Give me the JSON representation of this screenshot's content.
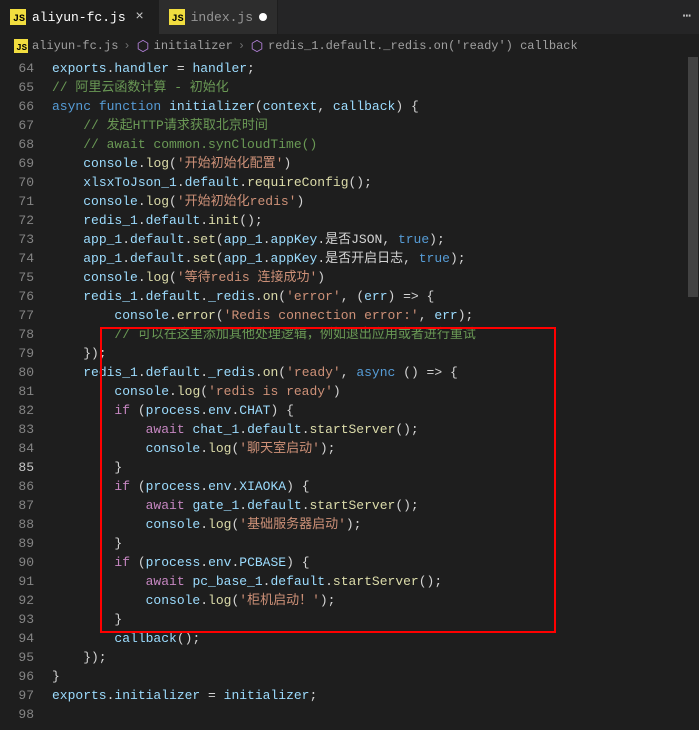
{
  "tabs": [
    {
      "label": "aliyun-fc.js",
      "active": true
    },
    {
      "label": "index.js",
      "active": false
    }
  ],
  "breadcrumb": {
    "file": "aliyun-fc.js",
    "symbol1": "initializer",
    "symbol2": "redis_1.default._redis.on('ready') callback"
  },
  "jsLabel": "JS",
  "gutter": {
    "start": 64,
    "end": 98,
    "current": 85
  },
  "code": [
    "exports.handler = handler;",
    "// 阿里云函数计算 - 初始化",
    "async function initializer(context, callback) {",
    "    // 发起HTTP请求获取北京时间",
    "    // await common.synCloudTime()",
    "    console.log('开始初始化配置')",
    "    xlsxToJson_1.default.requireConfig();",
    "    console.log('开始初始化redis')",
    "    redis_1.default.init();",
    "    app_1.default.set(app_1.appKey.是否JSON, true);",
    "    app_1.default.set(app_1.appKey.是否开启日志, true);",
    "    console.log('等待redis 连接成功')",
    "    redis_1.default._redis.on('error', (err) => {",
    "        console.error('Redis connection error:', err);",
    "        // 可以在这里添加其他处理逻辑，例如退出应用或者进行重试",
    "    });",
    "    redis_1.default._redis.on('ready', async () => {",
    "        console.log('redis is ready')",
    "        if (process.env.CHAT) {",
    "            await chat_1.default.startServer();",
    "            console.log('聊天室启动');",
    "        }",
    "        if (process.env.XIAOKA) {",
    "            await gate_1.default.startServer();",
    "            console.log('基础服务器启动');",
    "        }",
    "        if (process.env.PCBASE) {",
    "            await pc_base_1.default.startServer();",
    "            console.log('柜机启动！');",
    "        }",
    "        callback();",
    "    });",
    "}",
    "exports.initializer = initializer;",
    ""
  ]
}
